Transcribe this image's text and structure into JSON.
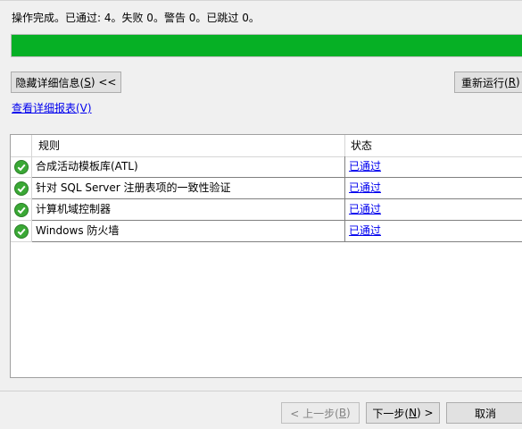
{
  "summary": "操作完成。已通过: 4。失败 0。警告 0。已跳过 0。",
  "progress": {
    "percent": 100,
    "color": "#06b025"
  },
  "buttons": {
    "hide_details_prefix": "隐藏详细信息(",
    "hide_details_key": "S",
    "hide_details_suffix": ") <<",
    "rerun_prefix": "重新运行(",
    "rerun_key": "R",
    "rerun_suffix": ")",
    "prev_prefix": "< 上一步(",
    "prev_key": "B",
    "prev_suffix": ")",
    "next_prefix": "下一步(",
    "next_key": "N",
    "next_suffix": ") >",
    "cancel": "取消"
  },
  "report_link": "查看详细报表(V)",
  "table": {
    "headers": {
      "rule": "规则",
      "status": "状态"
    },
    "rows": [
      {
        "icon": "check-circle-icon",
        "rule": "合成活动模板库(ATL)",
        "status": "已通过"
      },
      {
        "icon": "check-circle-icon",
        "rule": "针对 SQL Server 注册表项的一致性验证",
        "status": "已通过"
      },
      {
        "icon": "check-circle-icon",
        "rule": "计算机域控制器",
        "status": "已通过"
      },
      {
        "icon": "check-circle-icon",
        "rule": "Windows 防火墙",
        "status": "已通过"
      }
    ]
  },
  "colors": {
    "check": "#3aa835",
    "link": "#0000ee"
  }
}
